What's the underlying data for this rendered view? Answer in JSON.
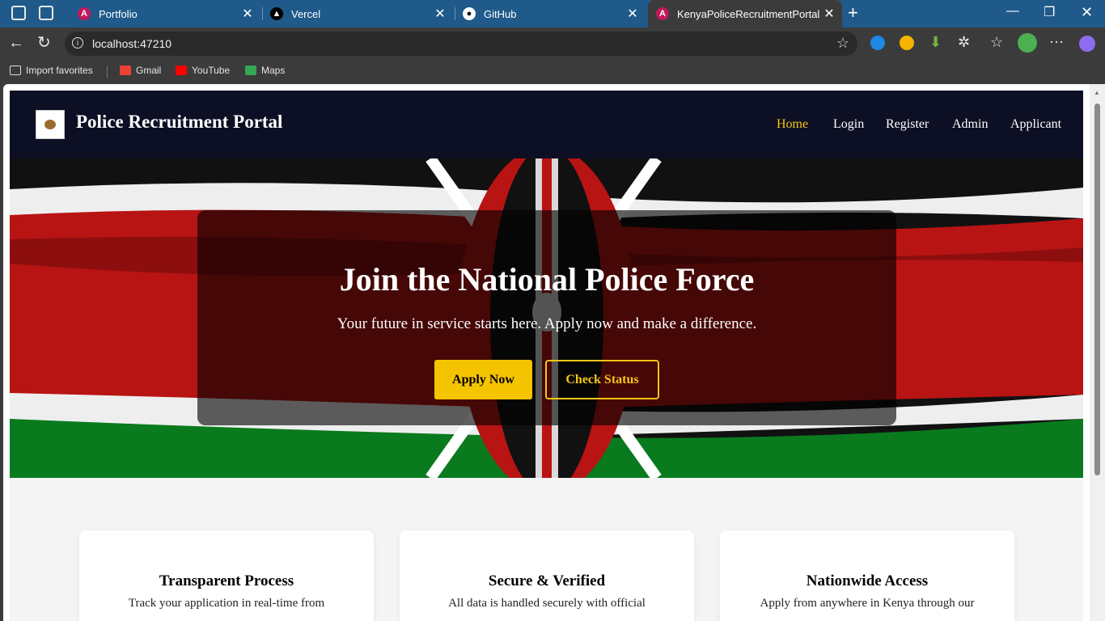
{
  "browser": {
    "tabs": [
      {
        "title": "Portfolio",
        "icon": "angular-icon"
      },
      {
        "title": "Vercel",
        "icon": "vercel-icon"
      },
      {
        "title": "GitHub",
        "icon": "github-icon"
      },
      {
        "title": "KenyaPoliceRecruitmentPortal",
        "icon": "angular-icon",
        "active": true
      }
    ],
    "url": "localhost:47210",
    "bookmarks": [
      {
        "label": "Import favorites",
        "icon": "import-icon"
      },
      {
        "label": "Gmail",
        "icon": "gmail-icon"
      },
      {
        "label": "YouTube",
        "icon": "youtube-icon"
      },
      {
        "label": "Maps",
        "icon": "maps-icon"
      }
    ]
  },
  "site": {
    "brand": "Police Recruitment Portal",
    "nav": [
      "Home",
      "Login",
      "Register",
      "Admin",
      "Applicant"
    ],
    "active_nav": "Home",
    "hero": {
      "title": "Join the National Police Force",
      "subtitle": "Your future in service starts here. Apply now and make a difference.",
      "primary_button": "Apply Now",
      "secondary_button": "Check Status"
    },
    "features": [
      {
        "title": "Transparent Process",
        "text": "Track your application in real-time from"
      },
      {
        "title": "Secure & Verified",
        "text": "All data is handled securely with official"
      },
      {
        "title": "Nationwide Access",
        "text": "Apply from anywhere in Kenya through our"
      }
    ]
  },
  "colors": {
    "accent": "#f5c518",
    "header_bg": "#0d0f24",
    "tabstrip": "#1f5a8a"
  }
}
